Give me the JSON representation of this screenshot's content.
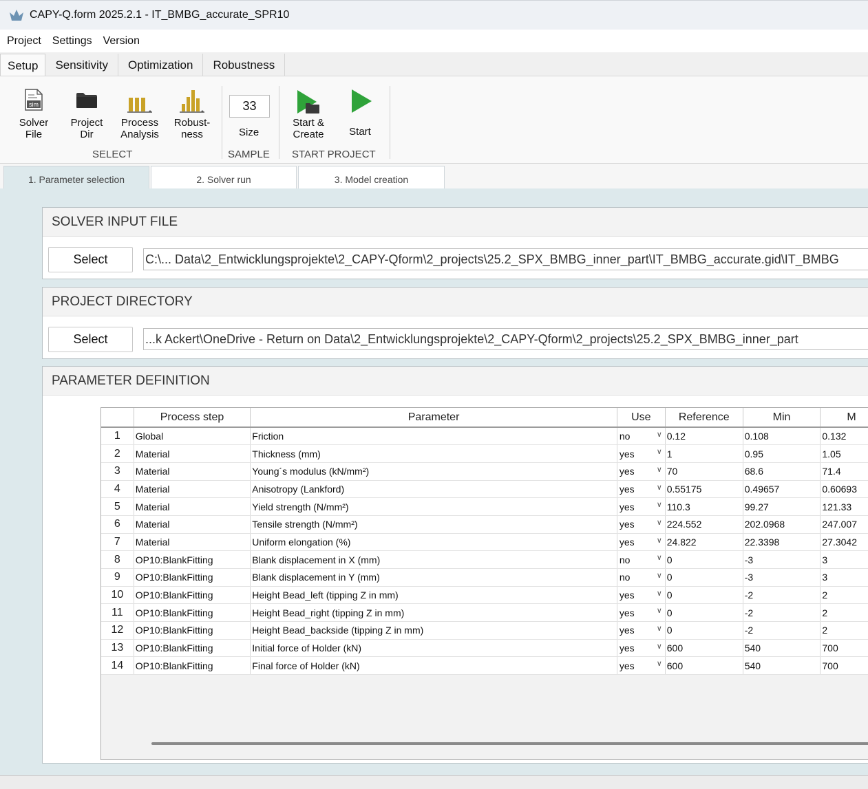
{
  "window": {
    "title": "CAPY-Q.form 2025.2.1 - IT_BMBG_accurate_SPR10"
  },
  "menu": [
    "Project",
    "Settings",
    "Version"
  ],
  "ribbon_tabs": [
    "Setup",
    "Sensitivity",
    "Optimization",
    "Robustness"
  ],
  "ribbon": {
    "solver_file": {
      "line1": "Solver",
      "line2": "File",
      "icon_text": "sim"
    },
    "project_dir": {
      "line1": "Project",
      "line2": "Dir"
    },
    "process_analysis": {
      "line1": "Process",
      "line2": "Analysis"
    },
    "robustness": {
      "line1": "Robust-",
      "line2": "ness"
    },
    "select_group": "SELECT",
    "sample_size": {
      "value": "33",
      "label": "Size"
    },
    "sample_group": "SAMPLE",
    "start_create": {
      "line1": "Start &",
      "line2": "Create"
    },
    "start": {
      "label": "Start"
    },
    "start_group": "START PROJECT"
  },
  "process_tabs": [
    "1. Parameter selection",
    "2. Solver run",
    "3. Model creation"
  ],
  "solver_input": {
    "heading": "SOLVER INPUT FILE",
    "button": "Select",
    "path": "C:\\... Data\\2_Entwicklungsprojekte\\2_CAPY-Qform\\2_projects\\25.2_SPX_BMBG_inner_part\\IT_BMBG_accurate.gid\\IT_BMBG"
  },
  "project_directory": {
    "heading": "PROJECT DIRECTORY",
    "button": "Select",
    "path": "...k Ackert\\OneDrive - Return on Data\\2_Entwicklungsprojekte\\2_CAPY-Qform\\2_projects\\25.2_SPX_BMBG_inner_part"
  },
  "parameter_definition": {
    "heading": "PARAMETER DEFINITION",
    "columns": [
      "",
      "Process step",
      "Parameter",
      "Use",
      "Reference",
      "Min",
      "M"
    ],
    "rows": [
      {
        "n": "1",
        "step": "Global",
        "param": "Friction",
        "use": "no",
        "ref": "0.12",
        "min": "0.108",
        "max": "0.132"
      },
      {
        "n": "2",
        "step": "Material",
        "param": "Thickness (mm)",
        "use": "yes",
        "ref": "1",
        "min": "0.95",
        "max": "1.05"
      },
      {
        "n": "3",
        "step": "Material",
        "param": "Young´s modulus (kN/mm²)",
        "use": "yes",
        "ref": "70",
        "min": "68.6",
        "max": "71.4"
      },
      {
        "n": "4",
        "step": "Material",
        "param": "Anisotropy (Lankford)",
        "use": "yes",
        "ref": "0.55175",
        "min": "0.49657",
        "max": "0.60693"
      },
      {
        "n": "5",
        "step": "Material",
        "param": "Yield strength (N/mm²)",
        "use": "yes",
        "ref": "110.3",
        "min": "99.27",
        "max": "121.33"
      },
      {
        "n": "6",
        "step": "Material",
        "param": "Tensile strength (N/mm²)",
        "use": "yes",
        "ref": "224.552",
        "min": "202.0968",
        "max": "247.007"
      },
      {
        "n": "7",
        "step": "Material",
        "param": "Uniform elongation (%)",
        "use": "yes",
        "ref": "24.822",
        "min": "22.3398",
        "max": "27.3042"
      },
      {
        "n": "8",
        "step": "OP10:BlankFitting",
        "param": "Blank displacement in X (mm)",
        "use": "no",
        "ref": "0",
        "min": "-3",
        "max": "3"
      },
      {
        "n": "9",
        "step": "OP10:BlankFitting",
        "param": "Blank displacement in Y (mm)",
        "use": "no",
        "ref": "0",
        "min": "-3",
        "max": "3"
      },
      {
        "n": "10",
        "step": "OP10:BlankFitting",
        "param": "Height Bead_left (tipping Z in mm)",
        "use": "yes",
        "ref": "0",
        "min": "-2",
        "max": "2"
      },
      {
        "n": "11",
        "step": "OP10:BlankFitting",
        "param": "Height Bead_right (tipping Z in mm)",
        "use": "yes",
        "ref": "0",
        "min": "-2",
        "max": "2"
      },
      {
        "n": "12",
        "step": "OP10:BlankFitting",
        "param": "Height Bead_backside (tipping Z in mm)",
        "use": "yes",
        "ref": "0",
        "min": "-2",
        "max": "2"
      },
      {
        "n": "13",
        "step": "OP10:BlankFitting",
        "param": "Initial force of Holder (kN)",
        "use": "yes",
        "ref": "600",
        "min": "540",
        "max": "700"
      },
      {
        "n": "14",
        "step": "OP10:BlankFitting",
        "param": "Final force of Holder (kN)",
        "use": "yes",
        "ref": "600",
        "min": "540",
        "max": "700"
      }
    ]
  },
  "colors": {
    "content_bg": "#dde9ec",
    "start_green": "#2fa33a",
    "icon_gold": "#c9a227"
  }
}
